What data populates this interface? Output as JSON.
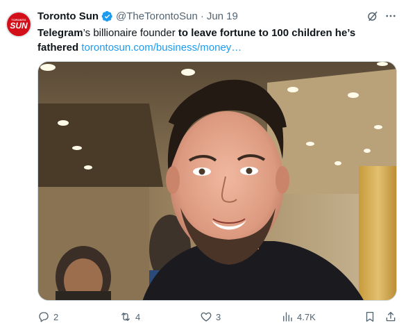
{
  "author": {
    "display_name": "Toronto Sun",
    "handle": "@TheTorontoSun",
    "separator": "·",
    "date": "Jun 19",
    "avatar_text_small": "TORONTO",
    "avatar_text_big": "SUN",
    "verified": true
  },
  "tweet": {
    "text_parts": {
      "p1": "Telegram",
      "p2": "’s billionaire founder ",
      "p3": "to leave fortune to 100 children he’s fathered",
      "p4": " "
    },
    "link": "torontosun.com/business/money…"
  },
  "media": {
    "description_icon": "photo-icon"
  },
  "actions": {
    "replies": "2",
    "reposts": "4",
    "likes": "3",
    "views": "4.7K"
  },
  "colors": {
    "accent": "#1d9bf0",
    "brand_red": "#d3101a",
    "muted_text": "#536471"
  }
}
